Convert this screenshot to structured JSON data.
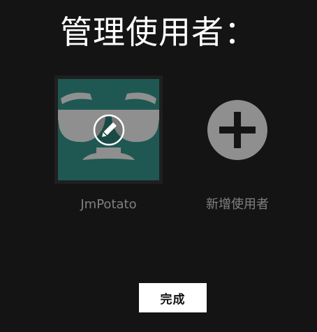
{
  "header": {
    "title": "管理使用者："
  },
  "profiles": [
    {
      "name": "JmPotato",
      "avatar_icon": "sunglasses-face-avatar",
      "avatar_bg": "#1f5852",
      "overlay_icon": "pencil-icon"
    }
  ],
  "add_profile": {
    "label": "新增使用者",
    "icon": "plus-circle-icon"
  },
  "footer": {
    "done_label": "完成"
  },
  "colors": {
    "background": "#141414",
    "title_text": "#ffffff",
    "label_text": "#808080",
    "button_bg": "#ffffff"
  }
}
